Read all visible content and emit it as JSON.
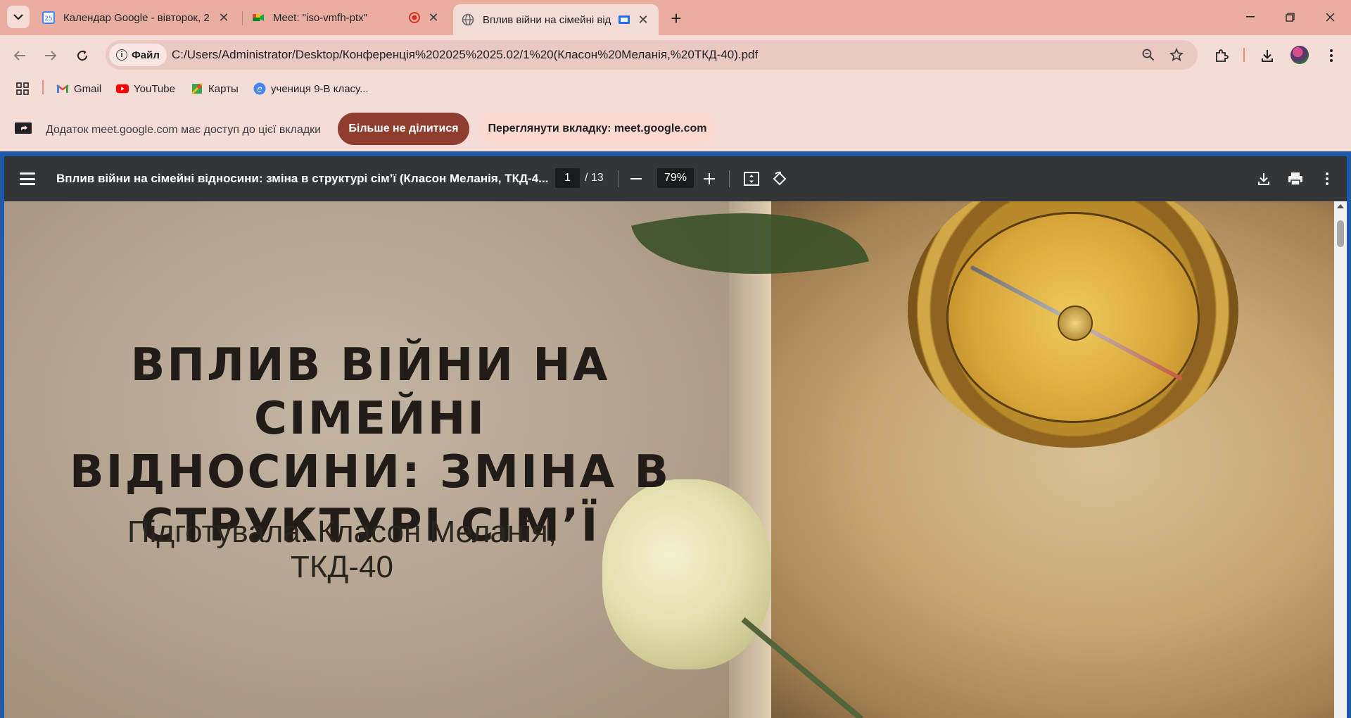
{
  "tabs": [
    {
      "title": "Календар Google - вівторок, 2",
      "icon": "google-calendar-icon",
      "badge": "25"
    },
    {
      "title": "Meet: \"iso-vmfh-ptx\"",
      "icon": "google-meet-icon"
    },
    {
      "title": "Вплив війни на сімейні від",
      "icon": "globe-icon",
      "active": true
    }
  ],
  "toolbar": {
    "file_chip": "Файл",
    "url": "C:/Users/Administrator/Desktop/Конференція%202025%2025.02/1%20(Класон%20Меланія,%20ТКД-40).pdf"
  },
  "bookmarks": [
    {
      "label": "Gmail",
      "icon": "gmail-icon"
    },
    {
      "label": "YouTube",
      "icon": "youtube-icon"
    },
    {
      "label": "Карты",
      "icon": "maps-icon"
    },
    {
      "label": "учениця 9-В класу...",
      "icon": "profile-icon"
    }
  ],
  "infobar": {
    "message": "Додаток meet.google.com має доступ до цієї вкладки",
    "stop_label": "Більше не ділитися",
    "view_label": "Переглянути вкладку: meet.google.com"
  },
  "pdf": {
    "title": "Вплив війни на сімейні відносини: зміна в структурі сім’ї (Класон Меланія, ТКД-4...",
    "page": "1",
    "total": "/ 13",
    "zoom": "79%"
  },
  "slide": {
    "title_line1": "ВПЛИВ ВІЙНИ НА СІМЕЙНІ",
    "title_line2": "ВІДНОСИНИ: ЗМІНА В",
    "title_line3": "СТРУКТУРІ СІМ’Ї",
    "author_line1": "Підготувала: Класон Меланія,",
    "author_line2": "ТКД-40"
  },
  "colors": {
    "tabstrip": "#eaaea1",
    "chrome": "#f6dcd6",
    "stop_button": "#8e3d2f",
    "pdf_toolbar": "#323639"
  }
}
